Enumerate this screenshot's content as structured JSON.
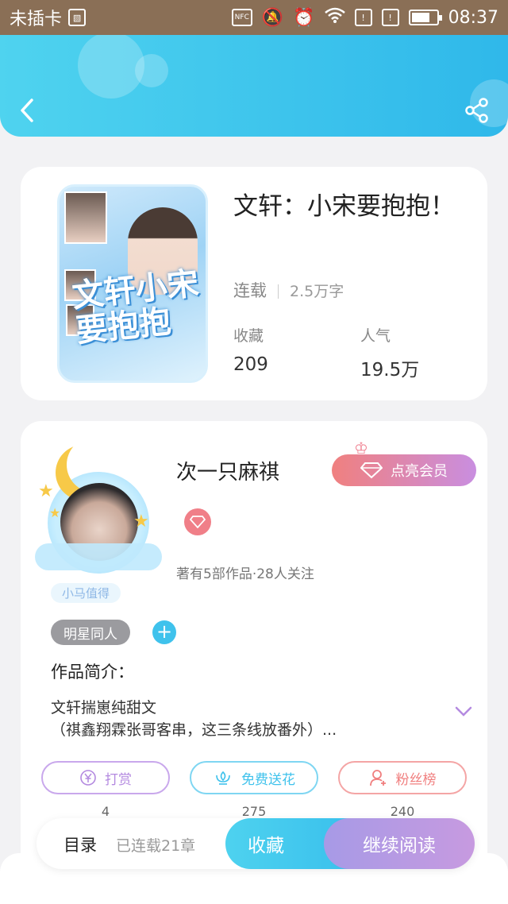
{
  "status_bar": {
    "carrier": "未插卡",
    "nfc": "NFC",
    "time": "08:37"
  },
  "header": {
    "back_icon": "chevron-left-icon",
    "share_icon": "share-icon",
    "accent": "#38c0ec"
  },
  "book": {
    "title": "文轩：小宋要抱抱！",
    "status": "连载",
    "word_count": "2.5万字",
    "collect_label": "收藏",
    "collect_value": "209",
    "popularity_label": "人气",
    "popularity_value": "19.5万",
    "cover_text": "文轩小宋要抱抱"
  },
  "author": {
    "name": "次一只麻祺",
    "vip_button": "点亮会员",
    "honor_tag": "小马值得",
    "info": "著有5部作品·28人关注",
    "tag": "明星同人",
    "add_tag": "+",
    "intro_heading": "作品简介：",
    "intro_line1": "文轩揣崽纯甜文",
    "intro_line2": "（祺鑫翔霖张哥客串，这三条线放番外）..."
  },
  "actions": [
    {
      "label": "打赏",
      "count": "4",
      "icon": "yen-icon",
      "color": "#b48ae0"
    },
    {
      "label": "免费送花",
      "count": "275",
      "icon": "flower-icon",
      "color": "#3fc2ec"
    },
    {
      "label": "粉丝榜",
      "count": "240",
      "icon": "user-icon",
      "color": "#f07f7f"
    }
  ],
  "bottom_bar": {
    "toc": "目录",
    "chapters": "已连载21章",
    "collect": "收藏",
    "continue": "继续阅读"
  }
}
